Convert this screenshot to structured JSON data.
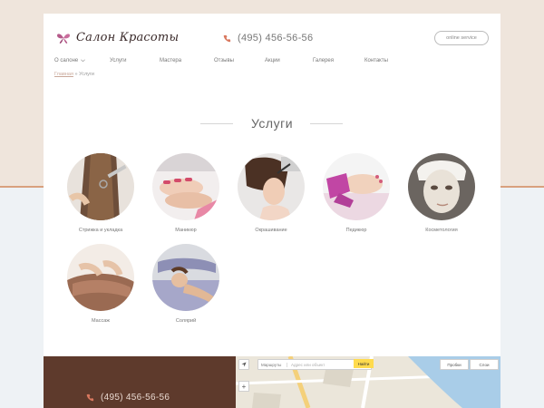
{
  "header": {
    "logo_text": "Салон Красоты",
    "phone": "(495) 456-56-56",
    "online_button": "online service"
  },
  "nav": {
    "items": [
      {
        "label": "О салоне",
        "has_dropdown": true
      },
      {
        "label": "Услуги"
      },
      {
        "label": "Мастера"
      },
      {
        "label": "Отзывы"
      },
      {
        "label": "Акции"
      },
      {
        "label": "Галерея"
      },
      {
        "label": "Контакты"
      }
    ]
  },
  "breadcrumb": {
    "home": "Главная",
    "separator": " » ",
    "current": "Услуги"
  },
  "section": {
    "title": "Услуги"
  },
  "services": [
    {
      "label": "Стрижка и укладка",
      "icon": "haircut-photo"
    },
    {
      "label": "Маникюр",
      "icon": "manicure-photo"
    },
    {
      "label": "Окрашивание",
      "icon": "hair-coloring-photo"
    },
    {
      "label": "Педикюр",
      "icon": "pedicure-photo"
    },
    {
      "label": "Косметология",
      "icon": "face-mask-photo"
    },
    {
      "label": "Массаж",
      "icon": "massage-photo"
    },
    {
      "label": "Солярий",
      "icon": "solarium-photo"
    }
  ],
  "footer": {
    "phone": "(495) 456-56-56"
  },
  "map": {
    "routes_label": "Маршруты",
    "search_placeholder": "Адрес или объект",
    "find_button": "Найти",
    "traffic_label": "Пробки",
    "layers_label": "Слои",
    "zoom_in": "+"
  },
  "colors": {
    "accent": "#c9a0a0",
    "footer_bg": "#5e3a2c",
    "logo_butterfly": "#b55a8a",
    "phone_icon": "#d9785f"
  }
}
